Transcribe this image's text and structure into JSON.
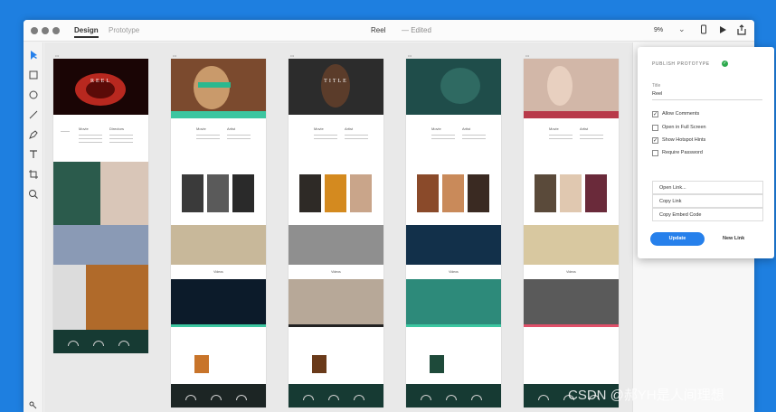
{
  "window": {
    "tabs": [
      {
        "label": "Design",
        "active": true
      },
      {
        "label": "Prototype",
        "active": false
      }
    ],
    "document_title": "Reel",
    "document_status": "— Edited",
    "zoom_value": "9%",
    "toolbar_icons": [
      "device-preview-icon",
      "play-icon",
      "share-icon"
    ]
  },
  "tools": [
    "select-tool-icon",
    "rectangle-tool-icon",
    "ellipse-tool-icon",
    "line-tool-icon",
    "pen-tool-icon",
    "text-tool-icon",
    "artboard-tool-icon",
    "zoom-tool-icon"
  ],
  "artboards": [
    {
      "hero_title": "REEL",
      "hero_color": "#b8281f",
      "stripe_color": "#ffffff",
      "section_left": "Movie",
      "section_right": "Directors"
    },
    {
      "hero_title": "",
      "hero_color": "#7b4a2e",
      "stripe_color": "#3cc6a0",
      "section_left": "Movie",
      "section_right": "Artist",
      "videos": "Videos"
    },
    {
      "hero_title": "TITLE",
      "hero_color": "#2c2c2c",
      "stripe_color": "#ffffff",
      "section_left": "Movie",
      "section_right": "Artist",
      "videos": "Videos"
    },
    {
      "hero_title": "",
      "hero_color": "#1f4d4a",
      "stripe_color": "#ffffff",
      "section_left": "Movie",
      "section_right": "Artist",
      "videos": "Videos"
    },
    {
      "hero_title": "",
      "hero_color": "#b83a4a",
      "stripe_color": "#ffffff",
      "section_left": "Movie",
      "section_right": "Artist",
      "videos": "Videos"
    }
  ],
  "popover": {
    "heading": "PUBLISH PROTOTYPE",
    "title_label": "Title",
    "title_value": "Reel",
    "options": [
      {
        "label": "Allow Comments",
        "checked": true
      },
      {
        "label": "Open in Full Screen",
        "checked": false
      },
      {
        "label": "Show Hotspot Hints",
        "checked": true
      },
      {
        "label": "Require Password",
        "checked": false
      }
    ],
    "links": [
      "Open Link...",
      "Copy Link",
      "Copy Embed Code"
    ],
    "update_label": "Update",
    "new_link_label": "New Link"
  },
  "watermark": "CSDN @郝YH是人间理想",
  "colors": {
    "background": "#1e7fe0",
    "accent": "#2680eb",
    "success": "#2eaa4e"
  }
}
